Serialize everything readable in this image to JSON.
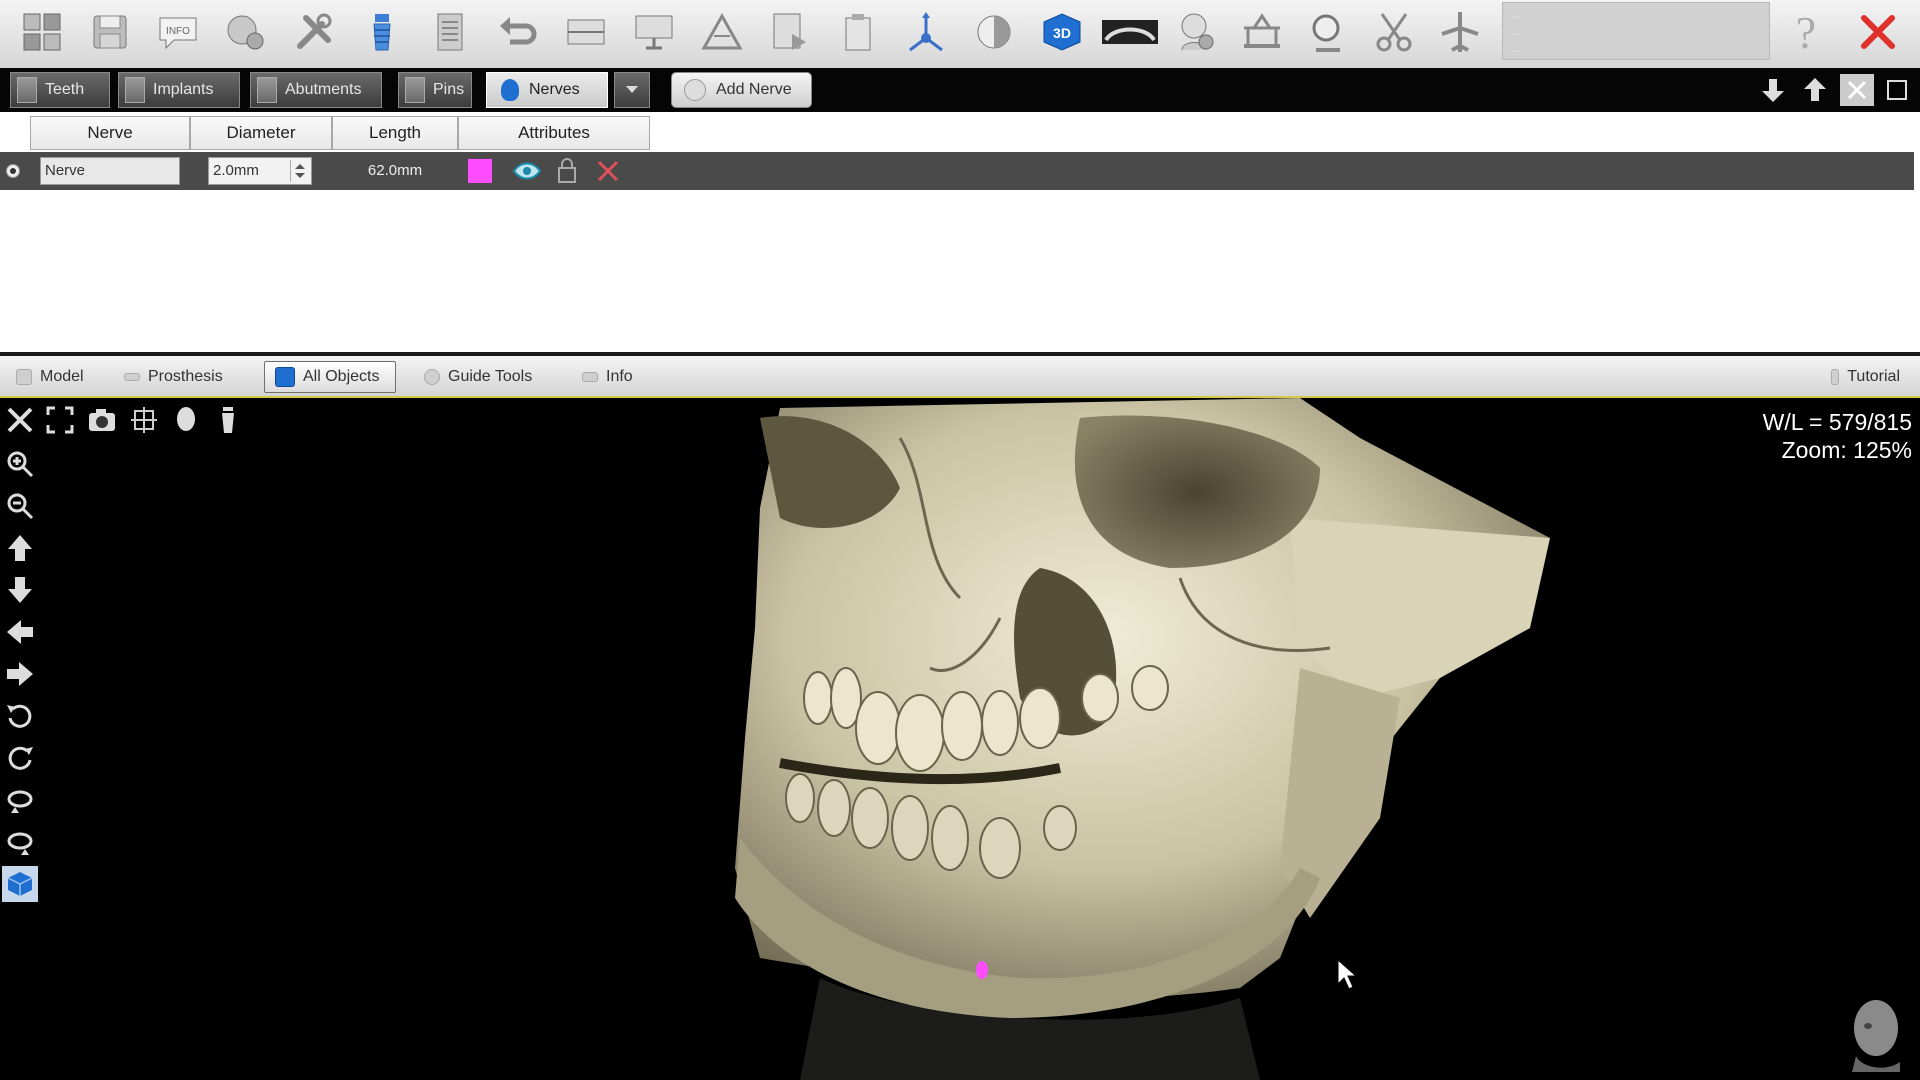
{
  "toolbar": {
    "icons": [
      "layout-icon",
      "save-icon",
      "info-icon",
      "render-settings-icon",
      "tools-icon",
      "implant-icon",
      "report-icon",
      "undo-icon",
      "align-icon",
      "monitor-icon",
      "measure-icon",
      "export-icon",
      "clipboard-icon",
      "axes-icon",
      "contrast-icon",
      "3d-view-icon",
      "panoramic-icon",
      "head-gear-icon",
      "bridge-icon",
      "zoom-search-icon",
      "cut-icon",
      "airplane-icon",
      "help-icon",
      "close-icon"
    ],
    "status_lines": [
      "...",
      "...",
      "..."
    ],
    "help_label": "?"
  },
  "object_tabs": [
    {
      "label": "Teeth"
    },
    {
      "label": "Implants"
    },
    {
      "label": "Abutments"
    },
    {
      "label": "Pins"
    },
    {
      "label": "Nerves"
    }
  ],
  "add_nerve_label": "Add Nerve",
  "table": {
    "columns": [
      "Nerve",
      "Diameter",
      "Length",
      "Attributes"
    ],
    "row": {
      "name": "Nerve",
      "diameter": "2.0mm",
      "length": "62.0mm",
      "color": "#ff4cff"
    }
  },
  "mode_tabs": [
    {
      "label": "Model"
    },
    {
      "label": "Prosthesis"
    },
    {
      "label": "All Objects"
    },
    {
      "label": "Guide Tools"
    },
    {
      "label": "Info"
    }
  ],
  "tutorial_label": "Tutorial",
  "viewport": {
    "wl": "W/L = 579/815",
    "zoom": "Zoom: 125%"
  },
  "colors": {
    "accent_blue": "#1e6fd0",
    "close_red": "#e0302a",
    "nerve_magenta": "#ff4cff"
  }
}
